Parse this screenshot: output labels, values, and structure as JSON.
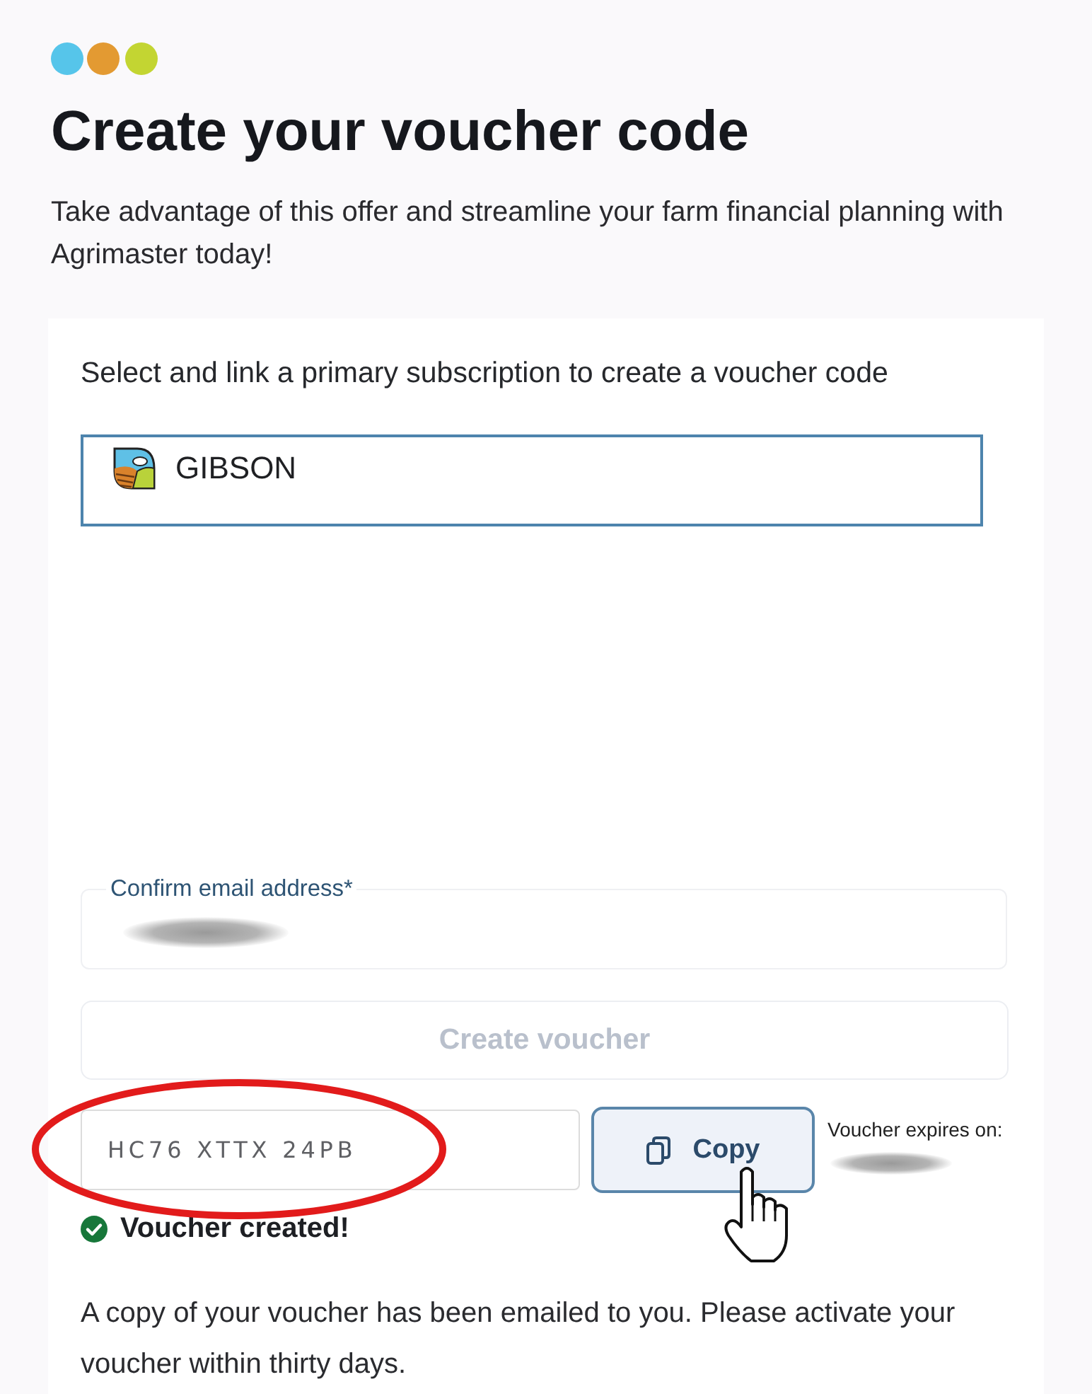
{
  "header": {
    "title": "Create your voucher code",
    "intro": "Take advantage of this offer and streamline your farm financial planning with Agrimaster today!"
  },
  "form": {
    "subscription_label": "Select and link a primary subscription to create a voucher code",
    "subscription": {
      "value": "GIBSON"
    },
    "email": {
      "label": "Confirm email address*"
    },
    "create_button": {
      "label": "Create voucher",
      "disabled": true
    },
    "voucher": {
      "code": "HC76 XTTX 24PB",
      "copy_button": "Copy",
      "expires_label": "Voucher expires on:"
    },
    "success": {
      "title": "Voucher created!",
      "message": "A copy of your voucher has been emailed to you. Please activate your voucher within thirty days."
    }
  }
}
